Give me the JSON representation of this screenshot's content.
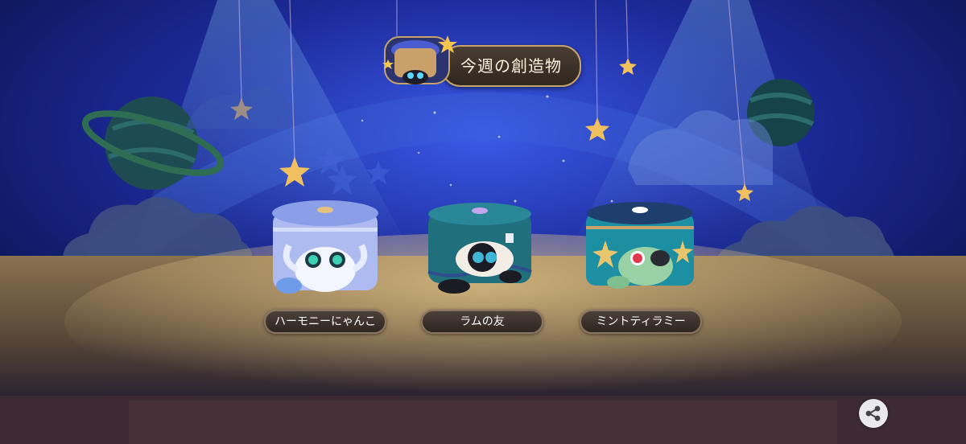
{
  "header": {
    "title": "今週の創造物"
  },
  "creatures": [
    {
      "name": "ハーモニーにゃんこ",
      "accent": "#b7c7f7",
      "eye": "#3fd1b6"
    },
    {
      "name": "ラムの友",
      "accent": "#1f6f7d",
      "eye": "#3fb6d6"
    },
    {
      "name": "ミントティラミー",
      "accent": "#1d8fa2",
      "eye": "#e0394e"
    }
  ],
  "icons": {
    "share": "share-icon",
    "emblem": "creature-emblem-icon"
  },
  "colors": {
    "sky": "#1a2a8a",
    "stage": "#6b5a43",
    "label_bg": "#3a302a",
    "star": "#f0c060"
  }
}
